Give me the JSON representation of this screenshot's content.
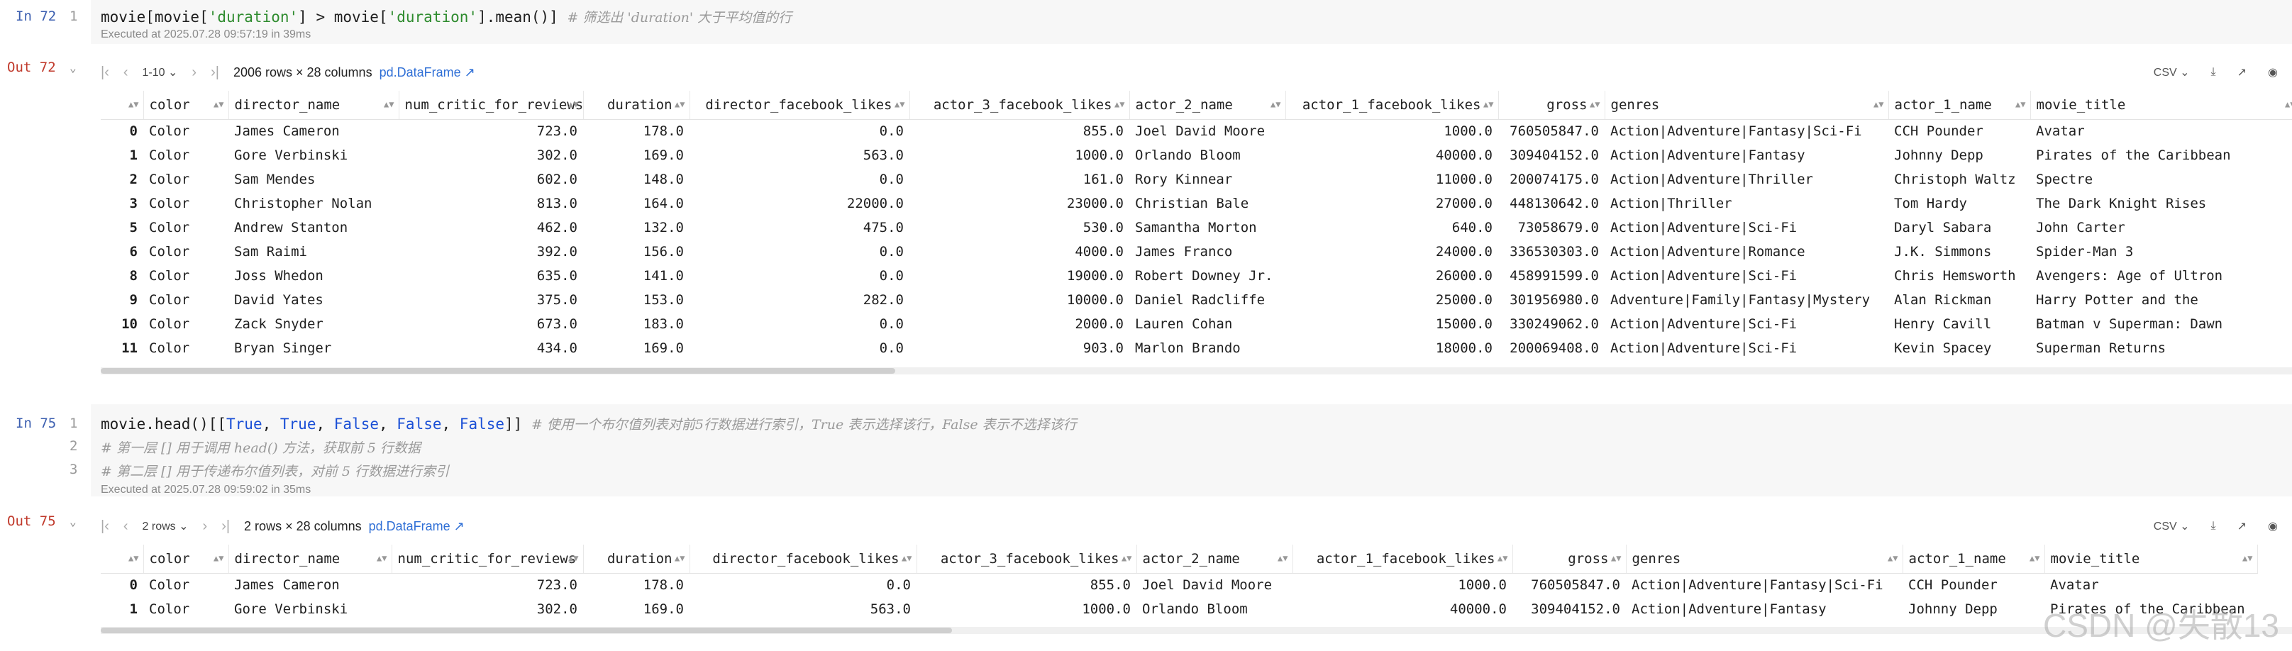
{
  "cell1": {
    "in_label": "In 72",
    "out_label": "Out 72",
    "line1_no": "1",
    "code_a": "movie[movie[",
    "code_str1": "'duration'",
    "code_b": "] > movie[",
    "code_str2": "'duration'",
    "code_c": "].mean()] ",
    "code_comment": "# 筛选出 'duration' 大于平均值的行",
    "executed": "Executed at 2025.07.28 09:57:19 in 39ms",
    "pager": "1-10",
    "summary": "2006 rows × 28 columns",
    "df_link": "pd.DataFrame ↗",
    "csv": "CSV",
    "columns": [
      "",
      "color",
      "director_name",
      "num_critic_for_reviews",
      "duration",
      "director_facebook_likes",
      "actor_3_facebook_likes",
      "actor_2_name",
      "actor_1_facebook_likes",
      "gross",
      "genres",
      "actor_1_name",
      "movie_title"
    ],
    "rows": [
      [
        "0",
        "Color",
        "James Cameron",
        "723.0",
        "178.0",
        "0.0",
        "855.0",
        "Joel David Moore",
        "1000.0",
        "760505847.0",
        "Action|Adventure|Fantasy|Sci-Fi",
        "CCH Pounder",
        "Avatar"
      ],
      [
        "1",
        "Color",
        "Gore Verbinski",
        "302.0",
        "169.0",
        "563.0",
        "1000.0",
        "Orlando Bloom",
        "40000.0",
        "309404152.0",
        "Action|Adventure|Fantasy",
        "Johnny Depp",
        "Pirates of the Caribbean"
      ],
      [
        "2",
        "Color",
        "Sam Mendes",
        "602.0",
        "148.0",
        "0.0",
        "161.0",
        "Rory Kinnear",
        "11000.0",
        "200074175.0",
        "Action|Adventure|Thriller",
        "Christoph Waltz",
        "Spectre"
      ],
      [
        "3",
        "Color",
        "Christopher Nolan",
        "813.0",
        "164.0",
        "22000.0",
        "23000.0",
        "Christian Bale",
        "27000.0",
        "448130642.0",
        "Action|Thriller",
        "Tom Hardy",
        "The Dark Knight Rises"
      ],
      [
        "5",
        "Color",
        "Andrew Stanton",
        "462.0",
        "132.0",
        "475.0",
        "530.0",
        "Samantha Morton",
        "640.0",
        "73058679.0",
        "Action|Adventure|Sci-Fi",
        "Daryl Sabara",
        "John Carter"
      ],
      [
        "6",
        "Color",
        "Sam Raimi",
        "392.0",
        "156.0",
        "0.0",
        "4000.0",
        "James Franco",
        "24000.0",
        "336530303.0",
        "Action|Adventure|Romance",
        "J.K. Simmons",
        "Spider-Man 3"
      ],
      [
        "8",
        "Color",
        "Joss Whedon",
        "635.0",
        "141.0",
        "0.0",
        "19000.0",
        "Robert Downey Jr.",
        "26000.0",
        "458991599.0",
        "Action|Adventure|Sci-Fi",
        "Chris Hemsworth",
        "Avengers: Age of Ultron"
      ],
      [
        "9",
        "Color",
        "David Yates",
        "375.0",
        "153.0",
        "282.0",
        "10000.0",
        "Daniel Radcliffe",
        "25000.0",
        "301956980.0",
        "Adventure|Family|Fantasy|Mystery",
        "Alan Rickman",
        "Harry Potter and the"
      ],
      [
        "10",
        "Color",
        "Zack Snyder",
        "673.0",
        "183.0",
        "0.0",
        "2000.0",
        "Lauren Cohan",
        "15000.0",
        "330249062.0",
        "Action|Adventure|Sci-Fi",
        "Henry Cavill",
        "Batman v Superman: Dawn"
      ],
      [
        "11",
        "Color",
        "Bryan Singer",
        "434.0",
        "169.0",
        "0.0",
        "903.0",
        "Marlon Brando",
        "18000.0",
        "200069408.0",
        "Action|Adventure|Sci-Fi",
        "Kevin Spacey",
        "Superman Returns"
      ]
    ]
  },
  "cell2": {
    "in_label": "In 75",
    "out_label": "Out 75",
    "line1_no": "1",
    "line2_no": "2",
    "line3_no": "3",
    "code_a": "movie.head()[[",
    "b1": "True",
    "b2": "True",
    "b3": "False",
    "b4": "False",
    "b5": "False",
    "sep": ", ",
    "code_c": "]] ",
    "code_comment1": "# 使用一个布尔值列表对前5行数据进行索引，True 表示选择该行，False 表示不选择该行",
    "code_comment2": "# 第一层 [] 用于调用 head() 方法，获取前 5 行数据",
    "code_comment3": "# 第二层 [] 用于传递布尔值列表，对前 5 行数据进行索引",
    "executed": "Executed at 2025.07.28 09:59:02 in 35ms",
    "pager": "2 rows",
    "summary": "2 rows × 28 columns",
    "df_link": "pd.DataFrame ↗",
    "csv": "CSV",
    "columns": [
      "",
      "color",
      "director_name",
      "num_critic_for_reviews",
      "duration",
      "director_facebook_likes",
      "actor_3_facebook_likes",
      "actor_2_name",
      "actor_1_facebook_likes",
      "gross",
      "genres",
      "actor_1_name",
      "movie_title"
    ],
    "rows": [
      [
        "0",
        "Color",
        "James Cameron",
        "723.0",
        "178.0",
        "0.0",
        "855.0",
        "Joel David Moore",
        "1000.0",
        "760505847.0",
        "Action|Adventure|Fantasy|Sci-Fi",
        "CCH Pounder",
        "Avatar"
      ],
      [
        "1",
        "Color",
        "Gore Verbinski",
        "302.0",
        "169.0",
        "563.0",
        "1000.0",
        "Orlando Bloom",
        "40000.0",
        "309404152.0",
        "Action|Adventure|Fantasy",
        "Johnny Depp",
        "Pirates of the Caribbean"
      ]
    ]
  },
  "watermark": "CSDN @失散13"
}
